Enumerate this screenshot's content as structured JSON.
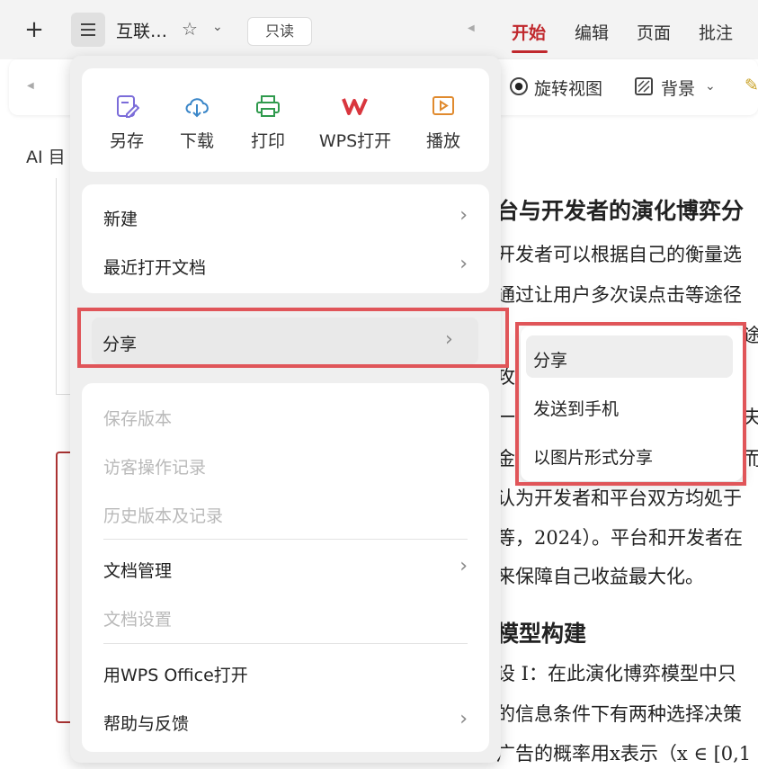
{
  "topbar": {
    "new_icon": "plus-icon",
    "menu_icon": "hamburger-icon",
    "doc_title": "互联…",
    "star_icon": "star-icon",
    "chevron_icon": "chevron-down-icon",
    "readonly_label": "只读",
    "tabs": [
      {
        "label": "开始",
        "active": true
      },
      {
        "label": "编辑",
        "active": false
      },
      {
        "label": "页面",
        "active": false
      },
      {
        "label": "批注",
        "active": false
      }
    ],
    "accent_color": "#c0282d"
  },
  "toolbar": {
    "rotate_label": "旋转视图",
    "background_label": "背景"
  },
  "sidebar": {
    "ai_label": "AI 目"
  },
  "document": {
    "heading1": "台与开发者的演化博弈分",
    "lines1": [
      "开发者可以根据自己的衡量选",
      "通过让用户多次误点击等途径",
      "",
      "攻",
      "一",
      "金",
      "认为开发者和平台双方均処于",
      "等，2024）。平台和开发者在",
      "来保障自己收益最大化。"
    ],
    "heading2": "模型构建",
    "lines2": [
      "设 I：在此演化博弈模型中只",
      "的信息条件下有两种选择决策",
      "广告的概率用x表示（x ∈ [0,1"
    ],
    "fragments": [
      "途",
      "夫",
      "而",
      "于"
    ]
  },
  "menu": {
    "quick_actions": [
      {
        "label": "另存",
        "icon": "save-as-icon",
        "color": "#7b6cd9"
      },
      {
        "label": "下载",
        "icon": "download-cloud-icon",
        "color": "#3a86c8"
      },
      {
        "label": "打印",
        "icon": "printer-icon",
        "color": "#2f9a4d"
      },
      {
        "label": "WPS打开",
        "icon": "wps-logo-icon",
        "color": "#d9363e"
      },
      {
        "label": "播放",
        "icon": "play-icon",
        "color": "#e08a2e"
      }
    ],
    "group1": [
      {
        "label": "新建",
        "arrow": true
      },
      {
        "label": "最近打开文档",
        "arrow": true
      }
    ],
    "share": {
      "label": "分享",
      "arrow": true
    },
    "group3": [
      {
        "label": "保存版本",
        "disabled": true
      },
      {
        "label": "访客操作记录",
        "disabled": true
      },
      {
        "label": "历史版本及记录",
        "disabled": true
      },
      {
        "label": "文档管理",
        "arrow": true,
        "disabled": false
      },
      {
        "label": "文档设置",
        "disabled": true
      },
      {
        "label": "用WPS Office打开",
        "disabled": false
      },
      {
        "label": "帮助与反馈",
        "arrow": true,
        "disabled": false
      }
    ],
    "highlight_color": "#e05559"
  },
  "submenu": {
    "items": [
      {
        "label": "分享"
      },
      {
        "label": "发送到手机"
      },
      {
        "label": "以图片形式分享"
      }
    ]
  }
}
